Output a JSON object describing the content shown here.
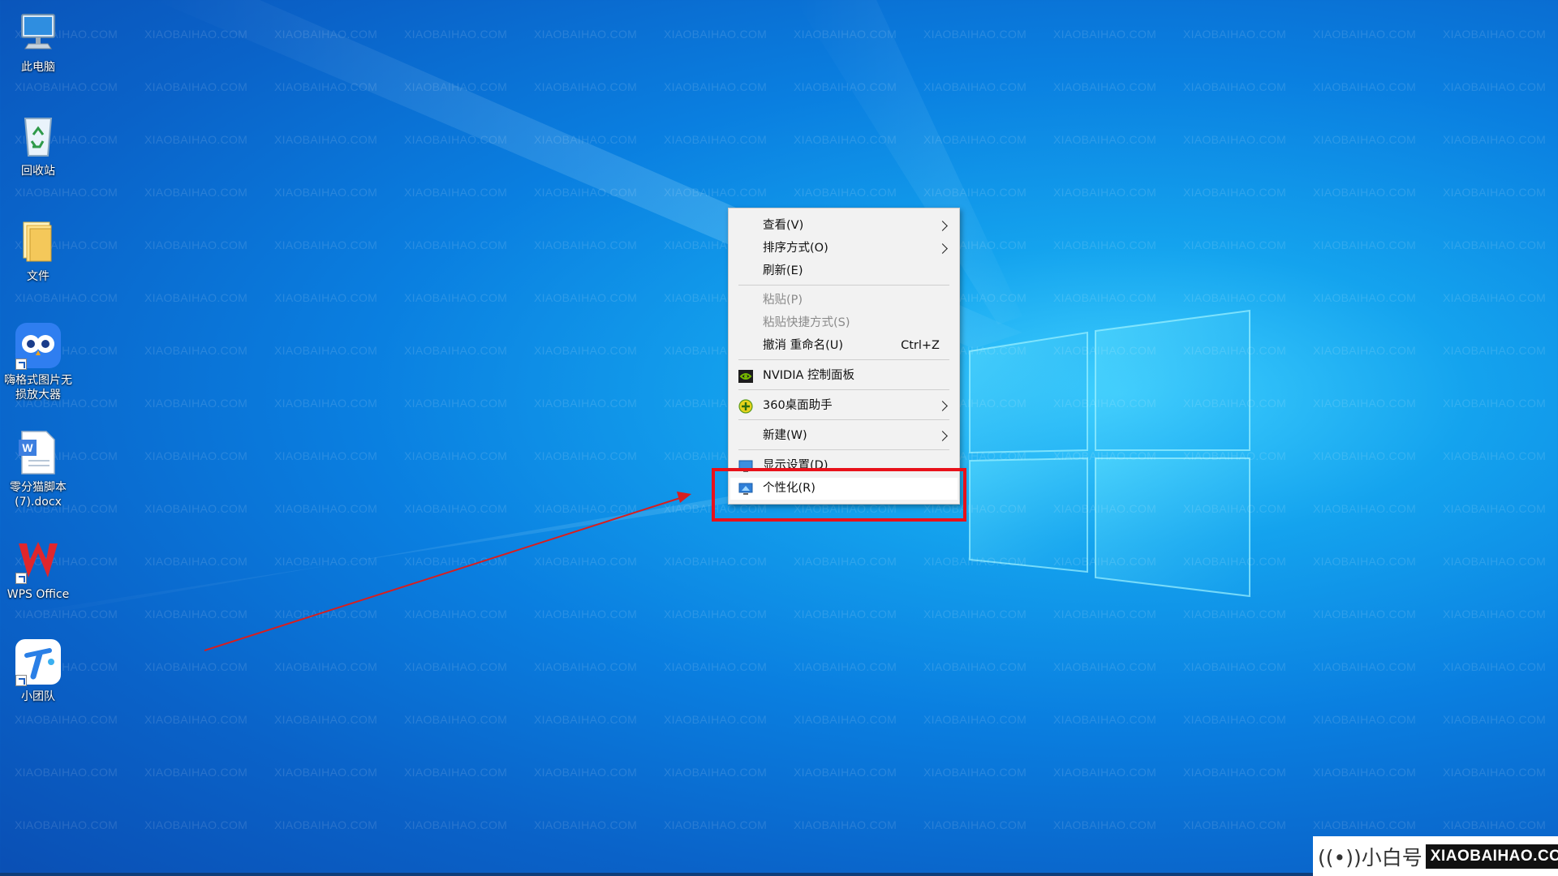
{
  "desktop": {
    "icons": [
      {
        "label": "此电脑",
        "icon": "computer-icon"
      },
      {
        "label": "回收站",
        "icon": "recycle-bin-icon"
      },
      {
        "label": "文件",
        "icon": "folder-icon"
      },
      {
        "label": "嗨格式图片无损放大器",
        "icon": "owl-app-icon"
      },
      {
        "label": "零分猫脚本(7).docx",
        "icon": "word-doc-icon"
      },
      {
        "label": "WPS Office",
        "icon": "wps-office-icon"
      },
      {
        "label": "小团队",
        "icon": "xiaotuandui-app-icon"
      }
    ],
    "watermark_text": "XIAOBAIHAO.COM"
  },
  "context_menu": {
    "items": [
      {
        "label": "查看(V)",
        "has_submenu": true,
        "enabled": true
      },
      {
        "label": "排序方式(O)",
        "has_submenu": true,
        "enabled": true
      },
      {
        "label": "刷新(E)",
        "has_submenu": false,
        "enabled": true
      },
      {
        "label": "粘贴(P)",
        "has_submenu": false,
        "enabled": false
      },
      {
        "label": "粘贴快捷方式(S)",
        "has_submenu": false,
        "enabled": false
      },
      {
        "label": "撤消 重命名(U)",
        "shortcut": "Ctrl+Z",
        "has_submenu": false,
        "enabled": true
      },
      {
        "label": "NVIDIA 控制面板",
        "icon": "nvidia-icon",
        "has_submenu": false,
        "enabled": true
      },
      {
        "label": "360桌面助手",
        "icon": "360-icon",
        "has_submenu": true,
        "enabled": true
      },
      {
        "label": "新建(W)",
        "has_submenu": true,
        "enabled": true
      },
      {
        "label": "显示设置(D)",
        "icon": "display-settings-icon",
        "has_submenu": false,
        "enabled": true
      },
      {
        "label": "个性化(R)",
        "icon": "personalize-icon",
        "has_submenu": false,
        "enabled": true,
        "highlighted": true
      }
    ]
  },
  "annotation": {
    "highlight_color": "#e8111a",
    "arrow_color": "#d81e1e"
  },
  "corner_logo": {
    "cn_text": "((•))小白号",
    "en_text": "XIAOBAIHAO.COM"
  }
}
